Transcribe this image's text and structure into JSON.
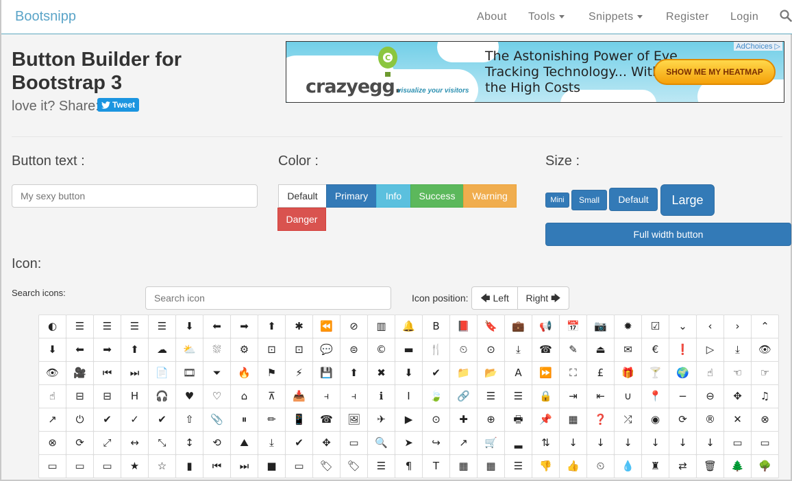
{
  "navbar": {
    "brand": "Bootsnipp",
    "items": [
      {
        "label": "About",
        "dropdown": false
      },
      {
        "label": "Tools",
        "dropdown": true
      },
      {
        "label": "Snippets",
        "dropdown": true
      },
      {
        "label": "Register",
        "dropdown": false
      },
      {
        "label": "Login",
        "dropdown": false
      }
    ],
    "search_icon": "search-icon"
  },
  "header": {
    "title": "Button Builder for Bootstrap 3",
    "share_text": "love it? Share:",
    "tweet_label": "Tweet"
  },
  "ad": {
    "logo": "crazyegg.",
    "tagline": "visualize your visitors",
    "headline": "The Astonishing Power of Eye Tracking Technology... Without the High Costs",
    "cta": "SHOW ME MY HEATMAP",
    "choices": "AdChoices"
  },
  "builder": {
    "button_text_label": "Button text :",
    "button_text_placeholder": "My sexy button",
    "color_label": "Color :",
    "colors": [
      {
        "label": "Default",
        "hex": "#ffffff"
      },
      {
        "label": "Primary",
        "hex": "#337ab7"
      },
      {
        "label": "Info",
        "hex": "#5bc0de"
      },
      {
        "label": "Success",
        "hex": "#5cb85c"
      },
      {
        "label": "Warning",
        "hex": "#f0ad4e"
      },
      {
        "label": "Danger",
        "hex": "#d9534f"
      }
    ],
    "size_label": "Size :",
    "sizes": [
      "Mini",
      "Small",
      "Default",
      "Large"
    ],
    "full_width_label": "Full width button"
  },
  "icons": {
    "section_label": "Icon:",
    "search_label": "Search icons:",
    "search_placeholder": "Search icon",
    "position_label": "Icon position:",
    "position_left": "Left",
    "position_right": "Right",
    "grid": [
      [
        "◐",
        "☰",
        "☰",
        "☰",
        "☰",
        "⬇",
        "⬅",
        "➡",
        "⬆",
        "✱",
        "⏪",
        "⊘",
        "▥",
        "🔔",
        "B",
        "📕",
        "🔖",
        "💼",
        "📢",
        "📅",
        "📷",
        "✹",
        "☑",
        "⌄",
        "‹",
        "›",
        "⌃"
      ],
      [
        "⬇",
        "⬅",
        "➡",
        "⬆",
        "☁",
        "⛅",
        "⛆",
        "⚙",
        "⊡",
        "⊡",
        "💬",
        "⊜",
        "©",
        "▬",
        "🍴",
        "⏲",
        "⊙",
        "⤓",
        "☎",
        "✎",
        "⏏",
        "✉",
        "€",
        "❗",
        "▷",
        "⤓",
        "👁"
      ],
      [
        "👁",
        "🎥",
        "⏮",
        "⏭",
        "📄",
        "🎞",
        "⏷",
        "🔥",
        "⚑",
        "⚡",
        "💾",
        "⬆",
        "✖",
        "⬇",
        "✔",
        "📁",
        "📂",
        "A",
        "⏩",
        "⛶",
        "£",
        "🎁",
        "🍸",
        "🌍",
        "☝",
        "☜",
        "☞"
      ],
      [
        "☝",
        "⊟",
        "⊟",
        "H",
        "🎧",
        "♥",
        "♡",
        "⌂",
        "⊼",
        "📥",
        "⫞",
        "⫞",
        "ℹ",
        "I",
        "🍃",
        "🔗",
        "☰",
        "☰",
        "🔒",
        "⇥",
        "⇤",
        "∪",
        "📍",
        "−",
        "⊖",
        "✥",
        "♫"
      ],
      [
        "↗",
        "⏻",
        "✔",
        "✓",
        "✔",
        "⇧",
        "📎",
        "⏸",
        "✏",
        "📱",
        "☎",
        "🖼",
        "✈",
        "▶",
        "⊙",
        "✚",
        "⊕",
        "🖶",
        "📌",
        "▦",
        "❓",
        "⤮",
        "◉",
        "⟳",
        "®",
        "✕",
        "⊗"
      ],
      [
        "⊗",
        "⟳",
        "⤢",
        "↔",
        "⤡",
        "↕",
        "⟲",
        "⛰",
        "⤓",
        "✔",
        "✥",
        "▭",
        "🔍",
        "➤",
        "↪",
        "↗",
        "🛒",
        "▂",
        "⇅",
        "↓",
        "↓",
        "↓",
        "↓",
        "↓",
        "↓",
        "▭",
        "▭"
      ],
      [
        "▭",
        "▭",
        "▭",
        "★",
        "☆",
        "▮",
        "⏮",
        "⏭",
        "■",
        "▭",
        "🏷",
        "🏷",
        "☰",
        "¶",
        "T",
        "▦",
        "▦",
        "☰",
        "👎",
        "👍",
        "⏲",
        "💧",
        "♜",
        "⇄",
        "🗑",
        "🌲",
        "🌳"
      ]
    ]
  }
}
